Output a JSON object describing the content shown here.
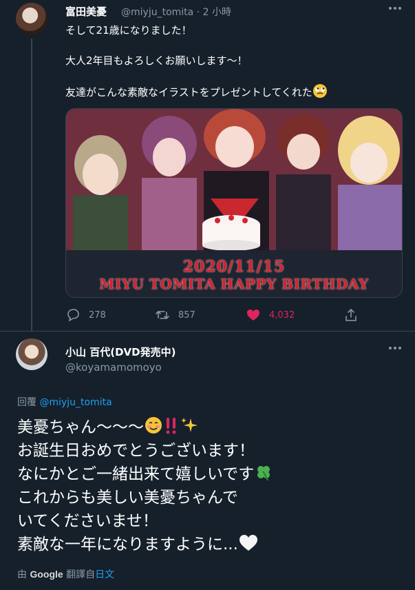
{
  "tweet1": {
    "display_name": "富田美憂",
    "handle": "@miyju_tomita",
    "time": "· 2 小時",
    "lines": [
      "そして21歳になりました！",
      "",
      "大人2年目もよろしくお願いします〜！",
      "",
      "友達がこんな素敵なイラストをプレゼントしてくれた"
    ],
    "image_caption_date": "2020/11/15",
    "image_caption_name": "MIYU TOMITA  HAPPY BIRTHDAY",
    "actions": {
      "replies": "278",
      "retweets": "857",
      "likes": "4,032"
    },
    "icons": [
      "reply-icon",
      "retweet-icon",
      "like-heart-icon",
      "share-icon",
      "more-icon",
      "rolling-eyes-emoji"
    ]
  },
  "tweet2": {
    "display_name": "小山 百代(DVD発売中)",
    "handle": "@koyamamomoyo",
    "reply_label": "回覆",
    "reply_target": "@miyju_tomita",
    "lines": [
      "美憂ちゃん〜〜〜",
      "お誕生日おめでとうございます！",
      "なにかとご一緒出来て嬉しいです",
      "これからも美しい美憂ちゃんで",
      "いてくださいませ！",
      "素敵な一年になりますように..."
    ],
    "translate_prefix": "由",
    "translate_brand": "Google",
    "translate_middle": "翻譯自",
    "translate_lang": "日文"
  },
  "colors": {
    "background": "#15202b",
    "accent": "#1da1f2",
    "like": "#e0245e",
    "muted": "#8899a6",
    "divider": "#38444d"
  }
}
